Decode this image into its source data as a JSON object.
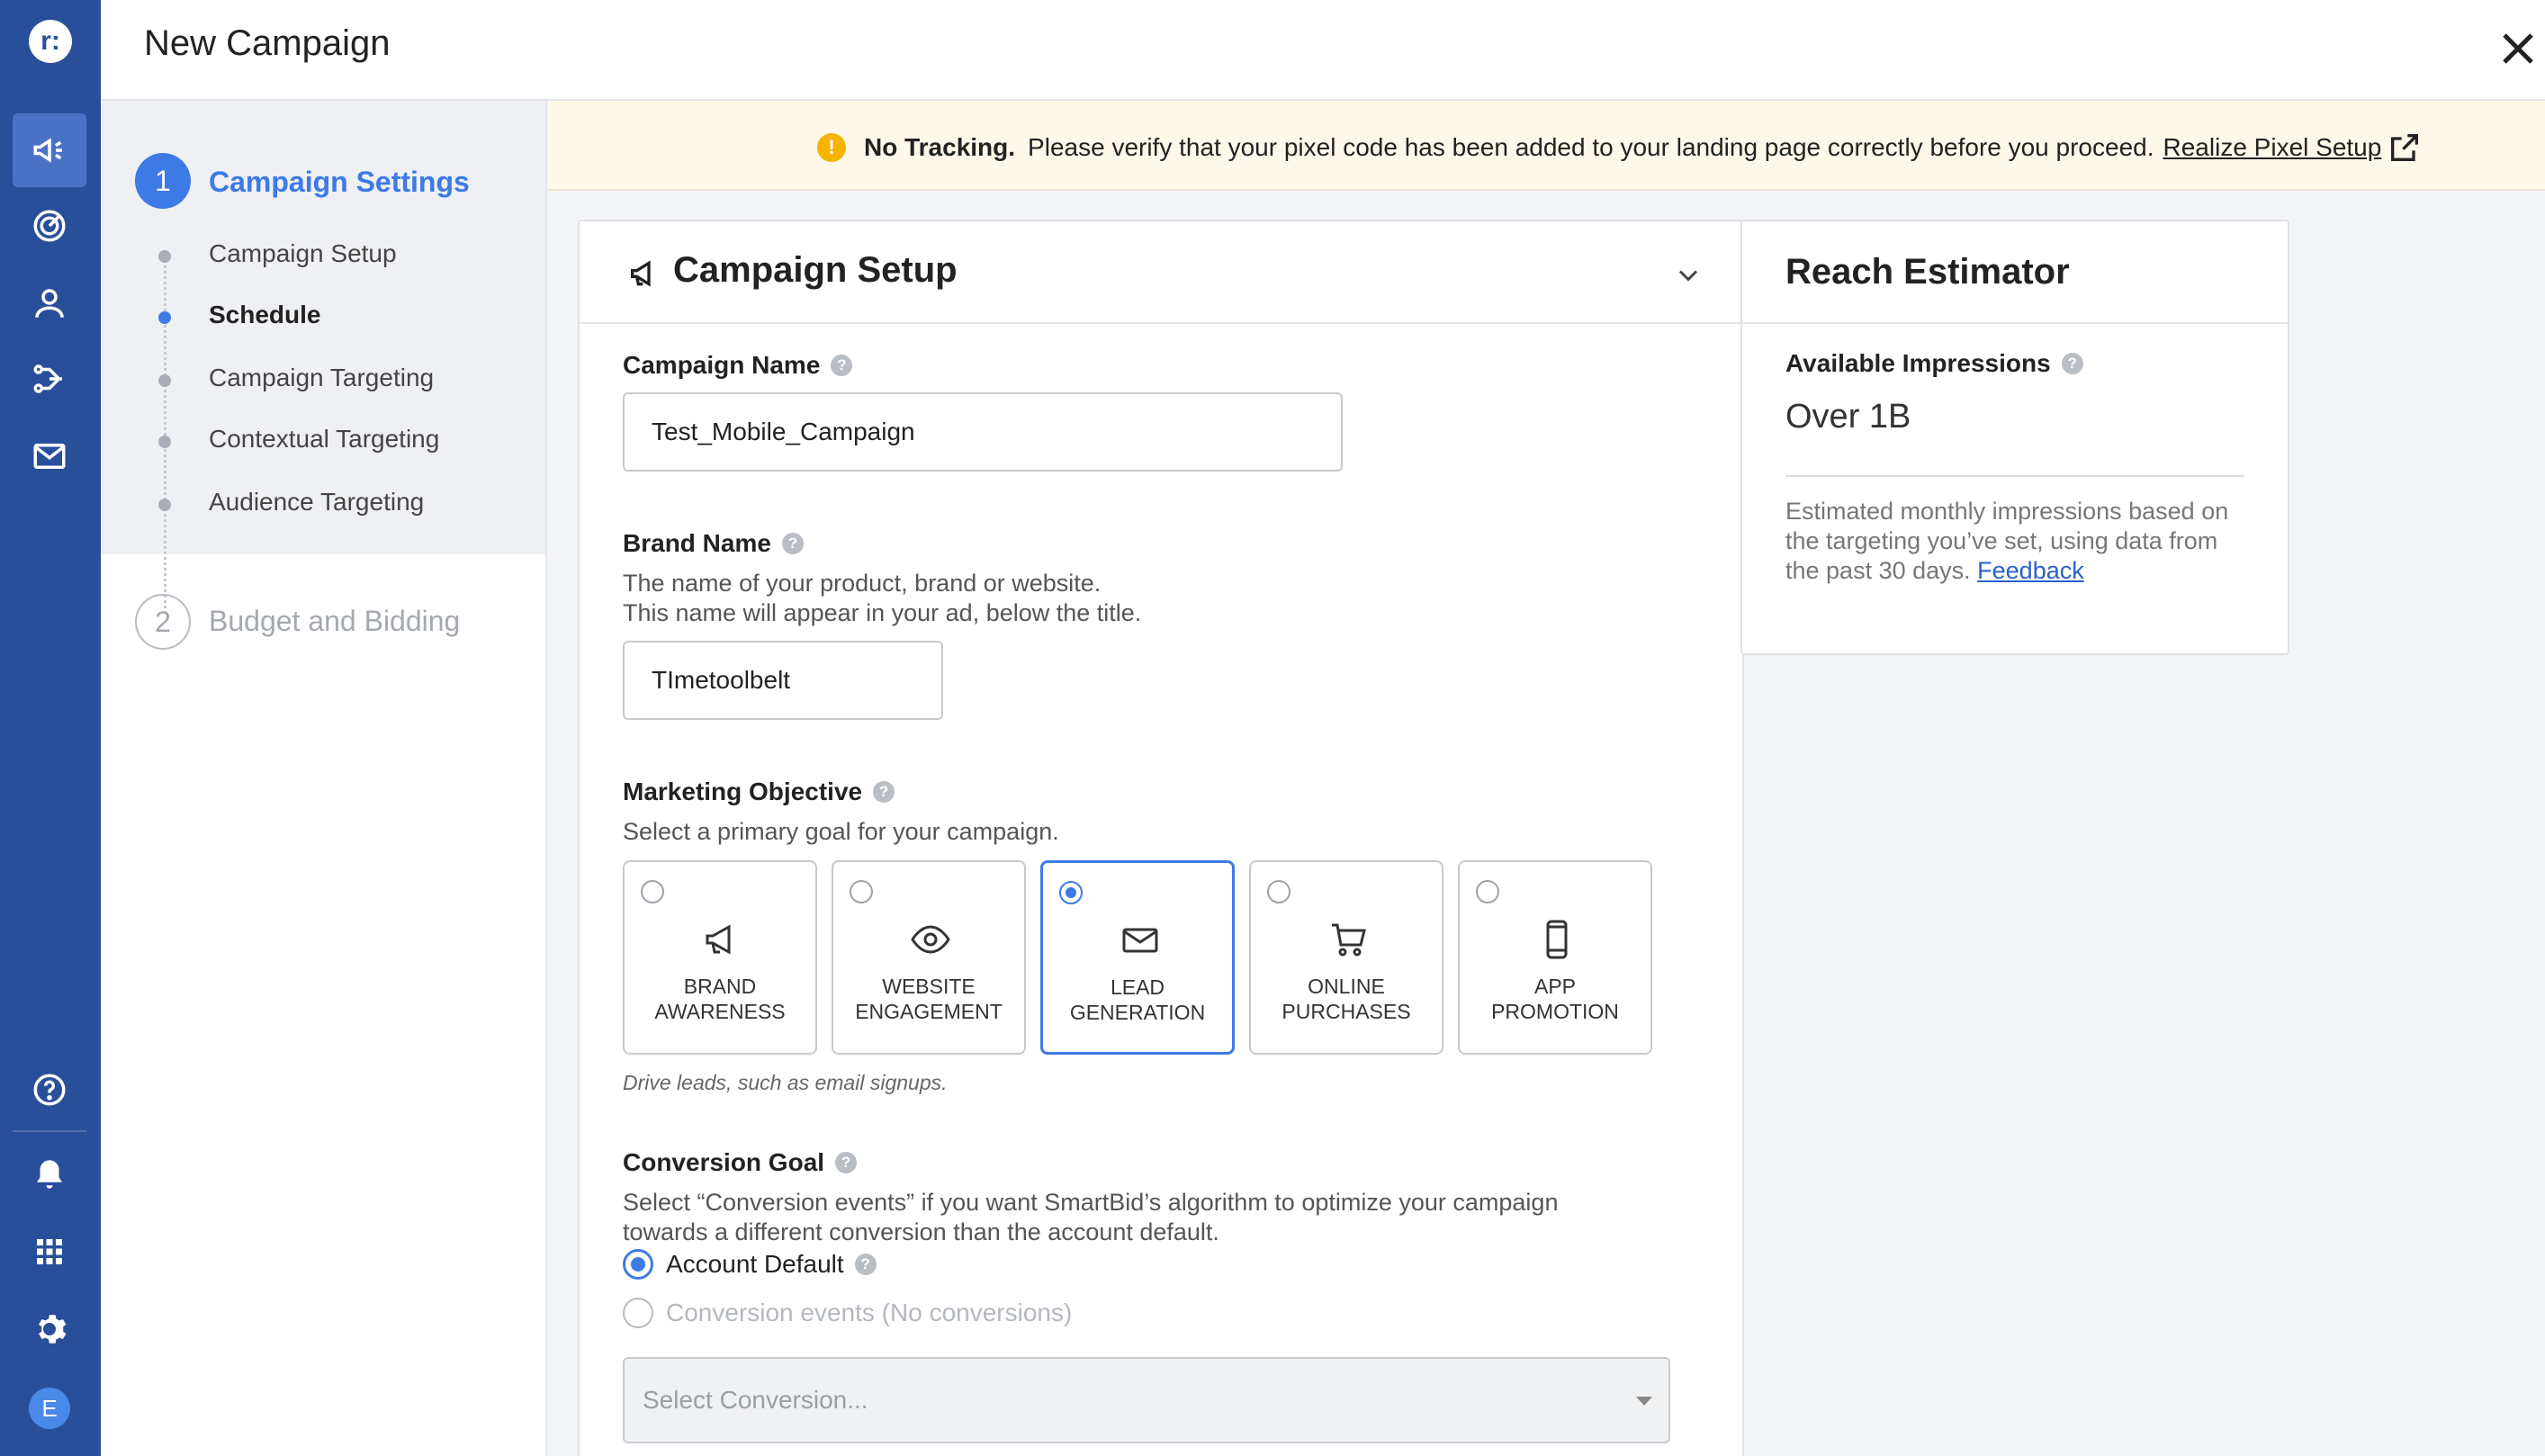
{
  "app": {
    "logo_letter": "r:",
    "avatar_letter": "E"
  },
  "header": {
    "title": "New Campaign"
  },
  "steps": {
    "step1": {
      "number": "1",
      "title": "Campaign Settings"
    },
    "substeps": [
      "Campaign Setup",
      "Schedule",
      "Campaign Targeting",
      "Contextual Targeting",
      "Audience Targeting"
    ],
    "step2": {
      "number": "2",
      "title": "Budget and Bidding"
    }
  },
  "banner": {
    "bold": "No Tracking.",
    "text": "Please verify that your pixel code has been added to your landing page correctly before you proceed.",
    "link": "Realize Pixel Setup"
  },
  "setup": {
    "title": "Campaign Setup",
    "campaign_name": {
      "label": "Campaign Name",
      "value": "Test_Mobile_Campaign"
    },
    "brand_name": {
      "label": "Brand Name",
      "desc1": "The name of your product, brand or website.",
      "desc2": "This name will appear in your ad, below the title.",
      "value": "TImetoolbelt"
    },
    "objective": {
      "label": "Marketing Objective",
      "desc": "Select a primary goal for your campaign.",
      "options": [
        {
          "line1": "BRAND",
          "line2": "AWARENESS",
          "icon": "megaphone-icon",
          "selected": false
        },
        {
          "line1": "WEBSITE",
          "line2": "ENGAGEMENT",
          "icon": "eye-icon",
          "selected": false
        },
        {
          "line1": "LEAD",
          "line2": "GENERATION",
          "icon": "envelope-icon",
          "selected": true
        },
        {
          "line1": "ONLINE",
          "line2": "PURCHASES",
          "icon": "cart-icon",
          "selected": false
        },
        {
          "line1": "APP",
          "line2": "PROMOTION",
          "icon": "phone-icon",
          "selected": false
        }
      ],
      "note": "Drive leads, such as email signups."
    },
    "conversion": {
      "label": "Conversion Goal",
      "desc1": "Select “Conversion events” if you want SmartBid’s algorithm to optimize your campaign",
      "desc2": "towards a different conversion than the account default.",
      "option_default": "Account Default",
      "option_events": "Conversion events (No conversions)",
      "select_placeholder": "Select Conversion..."
    }
  },
  "reach": {
    "title": "Reach Estimator",
    "sub_label": "Available Impressions",
    "value": "Over 1B",
    "desc": "Estimated monthly impressions based on the targeting you’ve set, using data from the past 30 days.",
    "link": "Feedback"
  },
  "colors": {
    "rail": "#2a4f9a",
    "accent": "#3d7ae6",
    "banner_bg": "#fdf8e8",
    "warning": "#f5b400"
  }
}
